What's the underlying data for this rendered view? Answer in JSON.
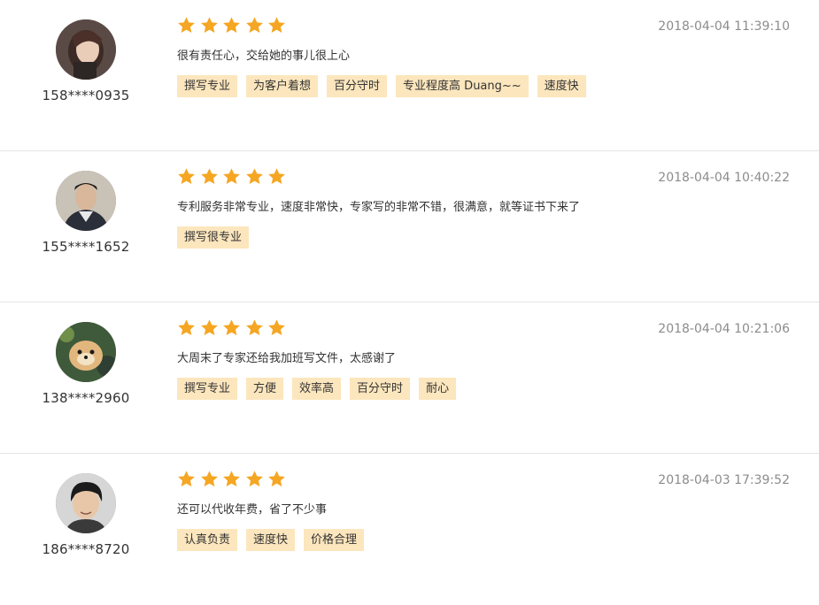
{
  "colors": {
    "star": "#f5a623",
    "tag_bg": "#fce6bd",
    "timestamp": "#8c8c8c",
    "divider": "#e6e6e6"
  },
  "reviews": [
    {
      "user": "158****0935",
      "rating": 5,
      "timestamp": "2018-04-04 11:39:10",
      "comment": "很有责任心，交给她的事儿很上心",
      "tags": [
        "撰写专业",
        "为客户着想",
        "百分守时",
        "专业程度高 Duang~~",
        "速度快"
      ]
    },
    {
      "user": "155****1652",
      "rating": 5,
      "timestamp": "2018-04-04 10:40:22",
      "comment": "专利服务非常专业，速度非常快，专家写的非常不错，很满意，就等证书下来了",
      "tags": [
        "撰写很专业"
      ]
    },
    {
      "user": "138****2960",
      "rating": 5,
      "timestamp": "2018-04-04 10:21:06",
      "comment": "大周末了专家还给我加班写文件，太感谢了",
      "tags": [
        "撰写专业",
        "方便",
        "效率高",
        "百分守时",
        "耐心"
      ]
    },
    {
      "user": "186****8720",
      "rating": 5,
      "timestamp": "2018-04-03 17:39:52",
      "comment": "还可以代收年费，省了不少事",
      "tags": [
        "认真负责",
        "速度快",
        "价格合理"
      ]
    }
  ]
}
